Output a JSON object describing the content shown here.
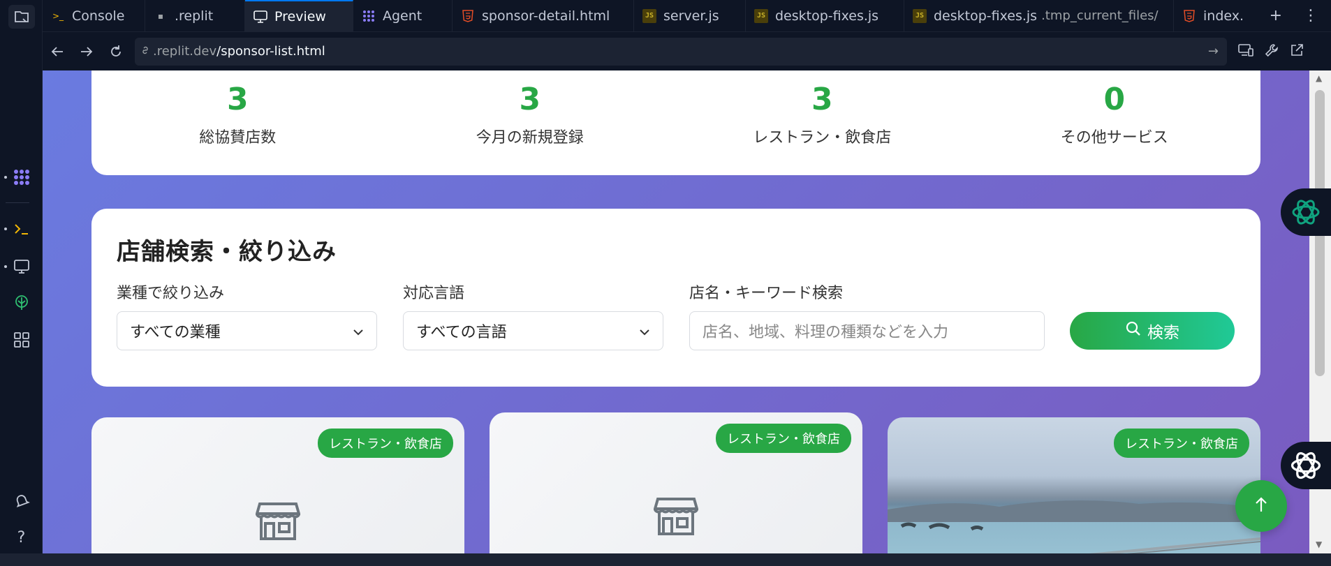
{
  "tabs": [
    {
      "label": "Console",
      "icon": "terminal-icon"
    },
    {
      "label": ".replit",
      "icon": "file-icon"
    },
    {
      "label": "Preview",
      "icon": "monitor-icon",
      "active": true
    },
    {
      "label": "Agent",
      "icon": "agent-icon"
    },
    {
      "label": "sponsor-detail.html",
      "icon": "html-icon"
    },
    {
      "label": "server.js",
      "icon": "js-icon"
    },
    {
      "label": "desktop-fixes.js",
      "icon": "js-icon"
    },
    {
      "label": "desktop-fixes.js",
      "sub": ".tmp_current_files/",
      "icon": "js-icon"
    },
    {
      "label": "index.",
      "icon": "html-icon"
    }
  ],
  "address": {
    "host": ".replit.dev",
    "path": "/sponsor-list.html"
  },
  "stats": [
    {
      "value": "3",
      "label": "総協賛店数"
    },
    {
      "value": "3",
      "label": "今月の新規登録"
    },
    {
      "value": "3",
      "label": "レストラン・飲食店"
    },
    {
      "value": "0",
      "label": "その他サービス"
    }
  ],
  "filters": {
    "title": "店舗検索・絞り込み",
    "category_label": "業種で絞り込み",
    "category_value": "すべての業種",
    "language_label": "対応言語",
    "language_value": "すべての言語",
    "keyword_label": "店名・キーワード検索",
    "keyword_placeholder": "店名、地域、料理の種類などを入力",
    "search_button": "検索"
  },
  "shops": [
    {
      "badge": "レストラン・飲食店"
    },
    {
      "badge": "レストラン・飲食店"
    },
    {
      "badge": "レストラン・飲食店"
    }
  ],
  "colors": {
    "accent": "#28a745",
    "tab_active_border": "#0079f2",
    "bg_dark": "#0e1525"
  }
}
